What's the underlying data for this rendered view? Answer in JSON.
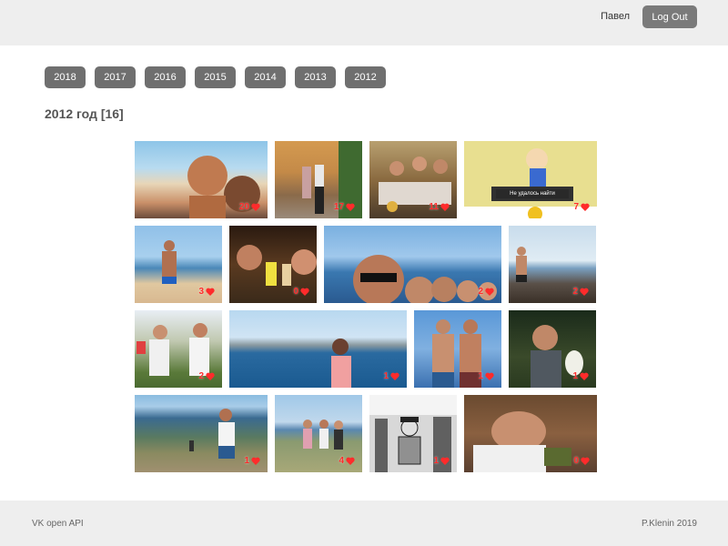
{
  "header": {
    "user_name": "Павел",
    "logout_label": "Log Out"
  },
  "years": [
    "2018",
    "2017",
    "2016",
    "2015",
    "2014",
    "2013",
    "2012"
  ],
  "section": {
    "title": "2012 год [16]"
  },
  "photos": [
    {
      "likes": "20",
      "alt": "couple selfie on beach"
    },
    {
      "likes": "17",
      "alt": "two people standing near building"
    },
    {
      "likes": "11",
      "alt": "group of friends sitting indoors"
    },
    {
      "likes": "7",
      "alt": "cartoon with caption"
    },
    {
      "likes": "3",
      "alt": "man on beach"
    },
    {
      "likes": "0",
      "alt": "friends at night with drinks"
    },
    {
      "likes": "2",
      "alt": "group selfie at sea"
    },
    {
      "likes": "2",
      "alt": "person by rocky shore"
    },
    {
      "likes": "2",
      "alt": "two men outdoors"
    },
    {
      "likes": "1",
      "alt": "woman at sea"
    },
    {
      "likes": "1",
      "alt": "two men shirtless on boat"
    },
    {
      "likes": "1",
      "alt": "man holding ice cream"
    },
    {
      "likes": "1",
      "alt": "man on coastal hill"
    },
    {
      "likes": "4",
      "alt": "group on coastal rocks"
    },
    {
      "likes": "1",
      "alt": "comic illustration"
    },
    {
      "likes": "0",
      "alt": "man sleeping"
    }
  ],
  "meme_caption": "Не удалось найти",
  "footer": {
    "left": "VK open API",
    "right": "P.Klenin 2019"
  },
  "colors": {
    "accent_button": "#6f6f6f",
    "heart": "#ff2b2b",
    "bar_bg": "#eeeeee"
  }
}
